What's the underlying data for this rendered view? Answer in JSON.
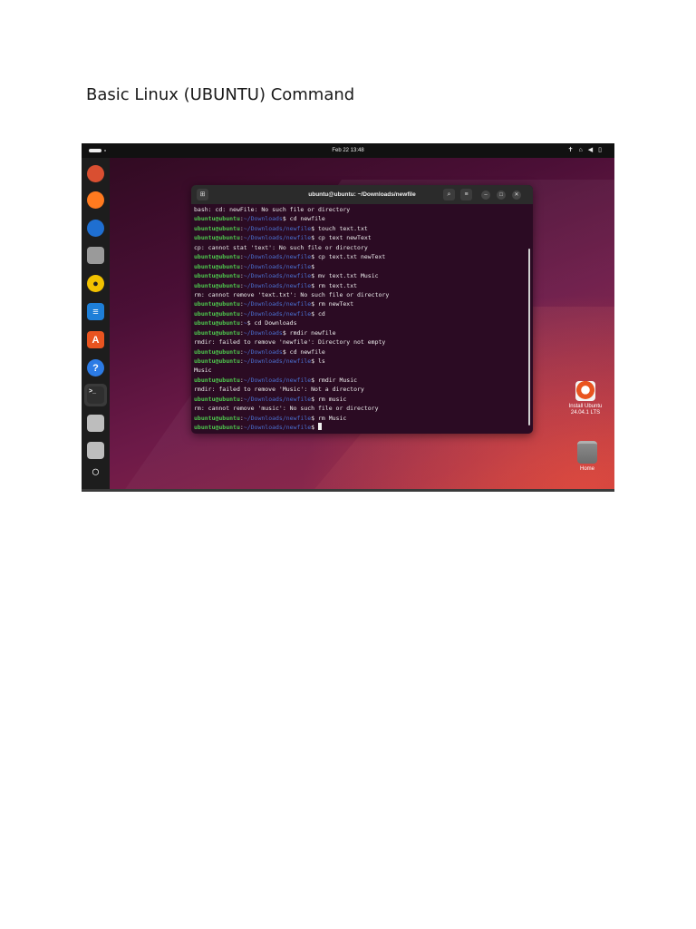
{
  "document": {
    "title": "Basic Linux (UBUNTU) Command"
  },
  "desktop": {
    "topbar": {
      "clock": "Feb 22  13:48",
      "tray_icons": [
        "accessibility-icon",
        "network-icon",
        "volume-icon",
        "battery-icon"
      ]
    },
    "dock": {
      "items": [
        {
          "name": "installer-icon",
          "color": "#d94f31"
        },
        {
          "name": "firefox-icon",
          "color": "#ff7a1f"
        },
        {
          "name": "thunderbird-icon",
          "color": "#1f6fd1"
        },
        {
          "name": "files-icon",
          "color": "#9a9a9a"
        },
        {
          "name": "rhythmbox-icon",
          "color": "#f2c200"
        },
        {
          "name": "writer-icon",
          "color": "#1e7fd8"
        },
        {
          "name": "app-center-icon",
          "color": "#e95420"
        },
        {
          "name": "help-icon",
          "color": "#2c7be5"
        },
        {
          "name": "terminal-icon",
          "color": "#2f2f2f"
        },
        {
          "name": "drive-icon",
          "color": "#bdbdbd"
        },
        {
          "name": "drive-icon-2",
          "color": "#bdbdbd"
        },
        {
          "name": "ubuntu-logo-icon",
          "color": "#ffffff"
        }
      ]
    },
    "icons": [
      {
        "label": "Install Ubuntu\n24.04.1 LTS"
      },
      {
        "label": "Home"
      }
    ]
  },
  "terminal": {
    "title": "ubuntu@ubuntu: ~/Downloads/newfile",
    "user": "ubuntu@ubuntu",
    "lines": [
      {
        "type": "out",
        "text": "bash: cd: newFile: No such file or directory"
      },
      {
        "type": "cmd",
        "path": "~/Downloads",
        "cmd": " cd newfile"
      },
      {
        "type": "cmd",
        "path": "~/Downloads/newfile",
        "cmd": " touch text.txt"
      },
      {
        "type": "cmd",
        "path": "~/Downloads/newfile",
        "cmd": " cp text newText"
      },
      {
        "type": "out",
        "text": "cp: cannot stat 'text': No such file or directory"
      },
      {
        "type": "cmd",
        "path": "~/Downloads/newfile",
        "cmd": " cp text.txt newText"
      },
      {
        "type": "cmd",
        "path": "~/Downloads/newfile",
        "cmd": ""
      },
      {
        "type": "cmd",
        "path": "~/Downloads/newfile",
        "cmd": " mv text.txt Music"
      },
      {
        "type": "cmd",
        "path": "~/Downloads/newfile",
        "cmd": " rm text.txt"
      },
      {
        "type": "out",
        "text": "rm: cannot remove 'text.txt': No such file or directory"
      },
      {
        "type": "cmd",
        "path": "~/Downloads/newfile",
        "cmd": " rm newText"
      },
      {
        "type": "cmd",
        "path": "~/Downloads/newfile",
        "cmd": " cd"
      },
      {
        "type": "cmd",
        "path": "~",
        "cmd": " cd Downloads"
      },
      {
        "type": "cmd",
        "path": "~/Downloads",
        "cmd": " rmdir newfile"
      },
      {
        "type": "out",
        "text": "rmdir: failed to remove 'newfile': Directory not empty"
      },
      {
        "type": "cmd",
        "path": "~/Downloads",
        "cmd": " cd newfile"
      },
      {
        "type": "cmd",
        "path": "~/Downloads/newfile",
        "cmd": " ls"
      },
      {
        "type": "out",
        "text": "Music"
      },
      {
        "type": "cmd",
        "path": "~/Downloads/newfile",
        "cmd": " rmdir Music"
      },
      {
        "type": "out",
        "text": "rmdir: failed to remove 'Music': Not a directory"
      },
      {
        "type": "cmd",
        "path": "~/Downloads/newfile",
        "cmd": " rm music"
      },
      {
        "type": "out",
        "text": "rm: cannot remove 'music': No such file or directory"
      },
      {
        "type": "cmd",
        "path": "~/Downloads/newfile",
        "cmd": " rm Music"
      },
      {
        "type": "cmd",
        "path": "~/Downloads/newfile",
        "cmd": "",
        "cursor": true
      }
    ]
  }
}
